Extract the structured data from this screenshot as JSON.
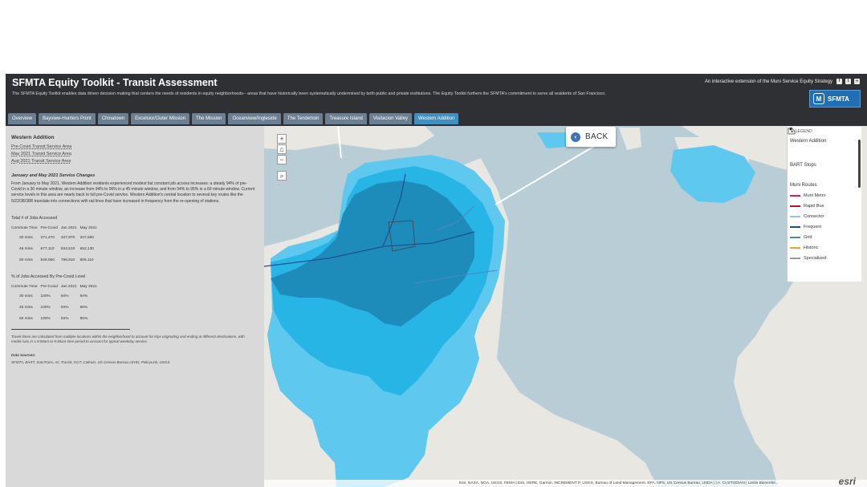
{
  "header": {
    "title": "SFMTA Equity Toolkit - Transit Assessment",
    "description": "The SFMTA Equity Toolkit enables data driven decision making that centers the needs of residents in equity neighborhoods-- areas that have historically been systematically undermined by both public and private institutions. The Equity Toolkit furthers the SFMTA's commitment to serve all residents of San Francisco.",
    "tagline": "An interactive extension of the Muni Service Equity Strategy",
    "logo_text": "SFMTA",
    "logo_mark": "M"
  },
  "tabs": [
    {
      "label": "Overview"
    },
    {
      "label": "Bayview-Hunters Point"
    },
    {
      "label": "Chinatown"
    },
    {
      "label": "Excelsior/Outer Mission"
    },
    {
      "label": "The Mission"
    },
    {
      "label": "Oceanview/Ingleside"
    },
    {
      "label": "The Tenderloin"
    },
    {
      "label": "Treasure Island"
    },
    {
      "label": "Visitacion Valley"
    },
    {
      "label": "Western Addition"
    }
  ],
  "active_tab": "Western Addition",
  "sidebar": {
    "heading": "Western Addition",
    "layers": [
      "Pre-Covid Transit Service Area",
      "May 2021 Transit Service Area",
      "Aug 2021 Transit Service Area"
    ],
    "changes_title": "January and May 2021 Service Changes",
    "changes_body": "From January to May 2021, Western Addition residents experienced modest but constant job access increases: a steady 94% of pre-Covid in a 30 minute window, an increase from 94% to 96% in a 45 minute window, and from 94% to 95% in a 60 minute window. Current service levels in this area are nearly back to full pre-Covid service. Western Addition's central location to several key routes like the 5/22/38/38R translate into connections with rail lines that have increased in frequency from the re-opening of stations.",
    "jobs_table": {
      "title": "Total # of Jobs Accessed",
      "headers": [
        "Commute Time",
        "Pre-Covid",
        "Jan 2021",
        "May 2021"
      ],
      "rows": [
        [
          "30 mins",
          "371,470",
          "347,970",
          "347,650"
        ],
        [
          "45 mins",
          "677,110",
          "634,510",
          "652,130"
        ],
        [
          "60 mins",
          "849,050",
          "796,810",
          "806,110"
        ]
      ]
    },
    "pct_table": {
      "title": "% of Jobs Accessed By Pre-Covid Level",
      "headers": [
        "Commute Time",
        "Pre-Covid",
        "Jan 2021",
        "May 2021"
      ],
      "rows": [
        [
          "30 mins",
          "100%",
          "94%",
          "94%"
        ],
        [
          "45 mins",
          "100%",
          "94%",
          "96%"
        ],
        [
          "60 mins",
          "100%",
          "94%",
          "95%"
        ]
      ]
    },
    "footnote": "Travel times are calculated from multiple locations within the neighborhood to account for trips originating and ending at different destinations, with model runs in a 9:00am to 9:30am time period to account for typical weekday service.",
    "data_sources_title": "Data Sources:",
    "data_sources": "SFMTA, BART, SamTrans, AC Transit, GGT, Caltrain, US Census Bureau LEHD, PolicyLink, USGS."
  },
  "map": {
    "zoom_in": "+",
    "home": "⌂",
    "zoom_out": "−",
    "search": "⌕",
    "back_label": "BACK",
    "back_icon": "‹",
    "attribution": "Esri, NASA, NGA, USGS, FEMA | Esri, HERE, Garmin, INCREMENT P, USGS, Bureau of Land Management, EPA, NPS, US Census Bureau, USDA | | A. CUSTODIAN | Leslie Bienenfel...",
    "esri_logo": "esri",
    "colors": {
      "water": "#b9cdd7",
      "land": "#e9e7e2",
      "service_light": "#5ec8ee",
      "service_mid": "#27b5e6",
      "service_dark": "#1e8cbb"
    }
  },
  "legend": {
    "heading": "LEGEND",
    "group1": "Western Addition",
    "group2": "BART Stops",
    "group3": "Muni Routes",
    "routes": [
      {
        "label": "Muni Metro",
        "color": "#d6244f"
      },
      {
        "label": "Rapid Bus",
        "color": "#c4122f"
      },
      {
        "label": "Connector",
        "color": "#9cc3de"
      },
      {
        "label": "Frequent",
        "color": "#1f4f8f"
      },
      {
        "label": "Grid",
        "color": "#4a86c8"
      },
      {
        "label": "Historic",
        "color": "#e6a33a"
      },
      {
        "label": "Specialized",
        "color": "#999999"
      }
    ]
  }
}
